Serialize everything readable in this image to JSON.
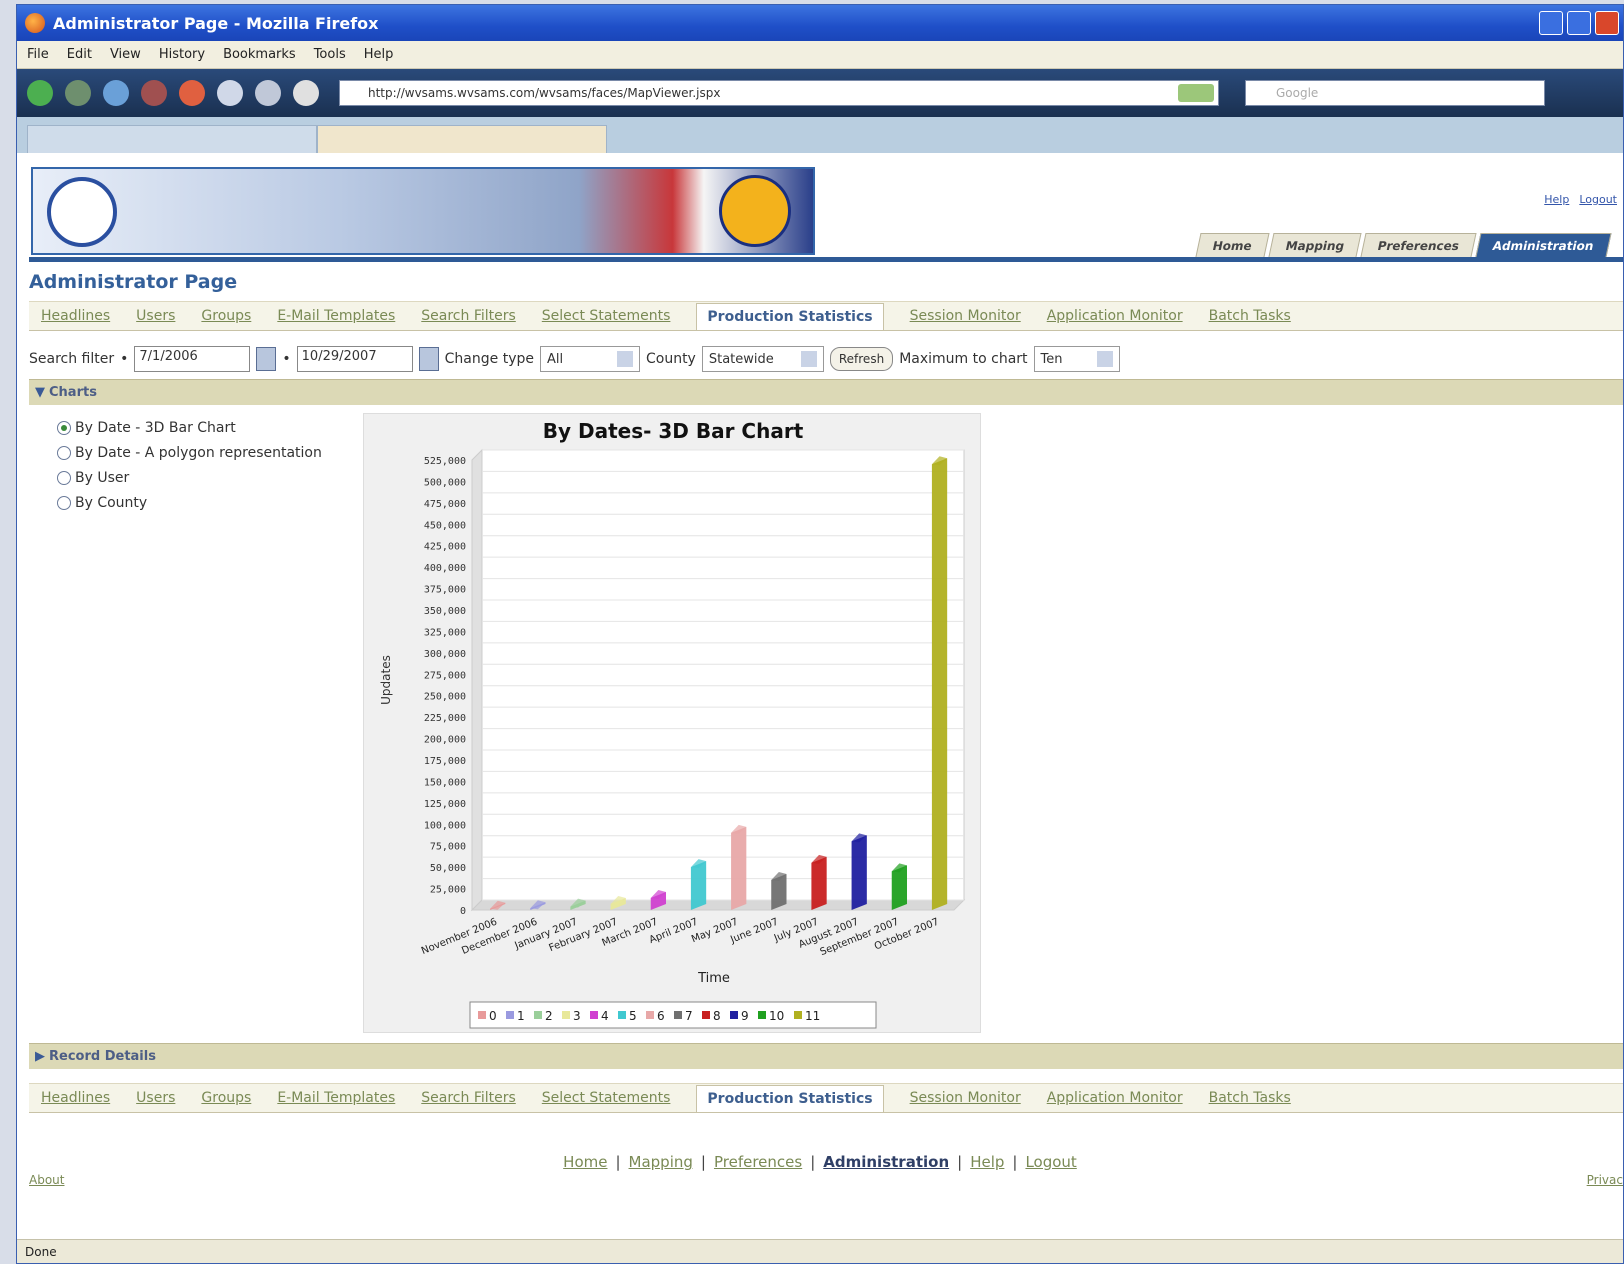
{
  "window": {
    "title": "Administrator Page - Mozilla Firefox"
  },
  "menu": [
    "File",
    "Edit",
    "View",
    "History",
    "Bookmarks",
    "Tools",
    "Help"
  ],
  "address": {
    "url": "http://wvsams.wvsams.com/wvsams/faces/MapViewer.jspx"
  },
  "search_engine": {
    "placeholder": "Google"
  },
  "top_links": {
    "help": "Help",
    "logout": "Logout"
  },
  "app_tabs": [
    "Home",
    "Mapping",
    "Preferences",
    "Administration"
  ],
  "page_title": "Administrator Page",
  "sub_tabs": [
    "Headlines",
    "Users",
    "Groups",
    "E-Mail Templates",
    "Search Filters",
    "Select Statements",
    "Production Statistics",
    "Session Monitor",
    "Application Monitor",
    "Batch Tasks"
  ],
  "selected_sub_tab": "Production Statistics",
  "filter": {
    "label": "Search filter",
    "from_date": "7/1/2006",
    "to_date": "10/29/2007",
    "change_type_label": "Change type",
    "change_type_value": "All",
    "county_label": "County",
    "county_value": "Statewide",
    "refresh_label": "Refresh",
    "max_label": "Maximum to chart",
    "max_value": "Ten"
  },
  "charts_section": {
    "title": "Charts"
  },
  "chart_options": [
    {
      "label": "By Date - 3D Bar Chart",
      "selected": true
    },
    {
      "label": "By Date - A polygon representation",
      "selected": false
    },
    {
      "label": "By User",
      "selected": false
    },
    {
      "label": "By County",
      "selected": false
    }
  ],
  "record_details_section": {
    "title": "Record Details"
  },
  "footer_links": [
    "Home",
    "Mapping",
    "Preferences",
    "Administration",
    "Help",
    "Logout"
  ],
  "about": "About",
  "privacy": "Privac",
  "status": "Done",
  "chart_data": {
    "type": "bar",
    "title": "By Dates- 3D Bar Chart",
    "xlabel": "Time",
    "ylabel": "Updates",
    "ylim": [
      0,
      525000
    ],
    "yticks": [
      "0",
      "25,000",
      "50,000",
      "75,000",
      "100,000",
      "125,000",
      "150,000",
      "175,000",
      "200,000",
      "225,000",
      "250,000",
      "275,000",
      "300,000",
      "325,000",
      "350,000",
      "375,000",
      "400,000",
      "425,000",
      "450,000",
      "475,000",
      "500,000",
      "525,000"
    ],
    "categories": [
      "November 2006",
      "December 2006",
      "January 2007",
      "February 2007",
      "March 2007",
      "April 2007",
      "May 2007",
      "June 2007",
      "July 2007",
      "August 2007",
      "September 2007",
      "October 2007"
    ],
    "values": [
      1500,
      2000,
      4000,
      7000,
      14000,
      50000,
      90000,
      35000,
      55000,
      80000,
      45000,
      520000
    ],
    "colors": [
      "#e89a9a",
      "#9a9ae0",
      "#9acf9a",
      "#e8e89a",
      "#d040d0",
      "#40c8d0",
      "#e8a8a8",
      "#707070",
      "#c82020",
      "#2020a0",
      "#20a020",
      "#b0b020"
    ],
    "legend": [
      "0",
      "1",
      "2",
      "3",
      "4",
      "5",
      "6",
      "7",
      "8",
      "9",
      "10",
      "11"
    ]
  }
}
